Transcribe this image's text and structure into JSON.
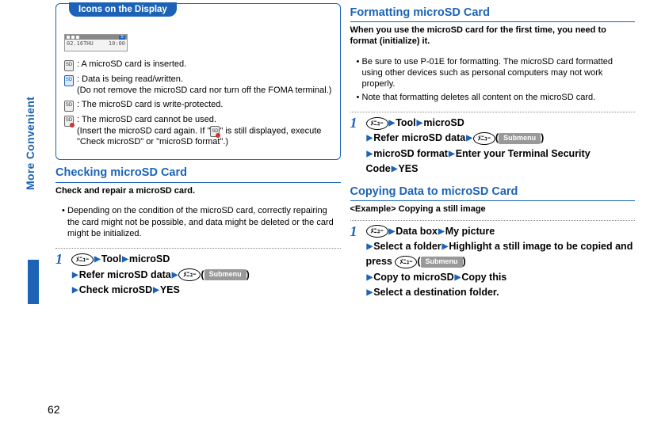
{
  "sideTab": "More Convenient",
  "pageNumber": "62",
  "box": {
    "title": "Icons on the Display",
    "lcd": {
      "date": "02.16THU",
      "time": "10:00"
    },
    "icons": [
      {
        "glyph": "SD",
        "cls": "ic-g",
        "text": "A microSD card is inserted."
      },
      {
        "glyph": "SD",
        "cls": "ic-blue",
        "text": "Data is being read/written.",
        "sub": "(Do not remove the microSD card nor turn off the FOMA terminal.)"
      },
      {
        "glyph": "SD",
        "cls": "ic-g",
        "text": "The microSD card is write-protected."
      },
      {
        "glyph": "SD",
        "cls": "ic-warn",
        "text": "The microSD card cannot be used.",
        "sub": "(Insert the microSD card again. If \"  \" is still displayed, execute \"Check microSD\" or \"microSD format\".)"
      }
    ]
  },
  "left": {
    "h1": "Checking microSD Card",
    "lead": "Check and repair a microSD card.",
    "bullets": [
      "Depending on the condition of the microSD card, correctly repairing the card might not be possible, and data might be deleted or the card might be initialized."
    ],
    "step": {
      "num": "1",
      "btn": "ﾒﾆｭｰ",
      "seg": [
        "Tool",
        "microSD",
        "Refer microSD data"
      ],
      "post": [
        "Check microSD",
        "YES"
      ],
      "sub_btn": "ﾒﾆｭｰ",
      "sub_lbl": "Submenu"
    }
  },
  "right": {
    "h1": "Formatting microSD Card",
    "lead": "When you use the microSD card for the first time, you need to format (initialize) it.",
    "bullets": [
      "Be sure to use P-01E for formatting. The microSD card formatted using other devices such as personal computers may not work properly.",
      "Note that formatting deletes all content on the microSD card."
    ],
    "step1": {
      "num": "1",
      "btn": "ﾒﾆｭｰ",
      "seg": [
        "Tool",
        "microSD",
        "Refer microSD data"
      ],
      "post": [
        "microSD format",
        "Enter your Terminal Security Code",
        "YES"
      ],
      "sub_btn": "ﾒﾆｭｰ",
      "sub_lbl": "Submenu"
    },
    "h2": "Copying Data to microSD Card",
    "lead2": "<Example> Copying a still image",
    "step2": {
      "num": "1",
      "btn": "ﾒﾆｭｰ",
      "seg": [
        "Data box",
        "My picture",
        "Select a folder",
        "Highlight a still image to be copied and press "
      ],
      "sub_btn": "ﾒﾆｭｰ",
      "sub_lbl": "Submenu",
      "post": [
        "Copy to microSD",
        "Copy this",
        "Select a destination folder."
      ]
    }
  }
}
